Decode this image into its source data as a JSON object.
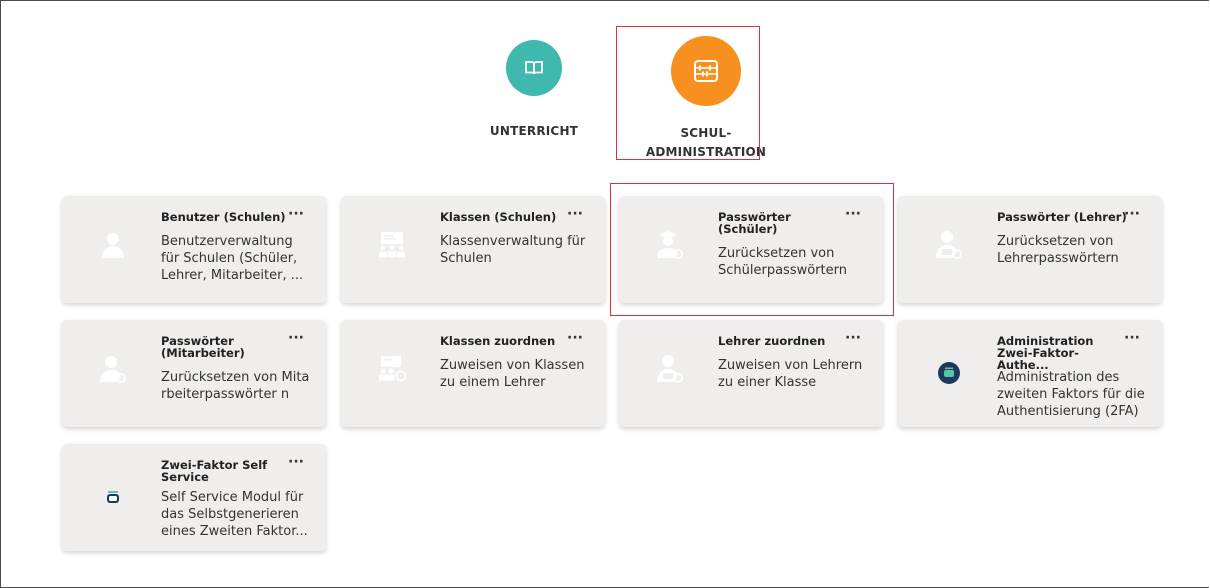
{
  "categories": [
    {
      "label": "UNTERRICHT",
      "icon": "book-icon",
      "color": "#3fb8ae"
    },
    {
      "label_line1": "SCHUL-",
      "label_line2": "ADMINISTRATION",
      "icon": "abacus-icon",
      "color": "#f7901e"
    }
  ],
  "tiles": [
    {
      "title": "Benutzer (Schulen)",
      "desc": "Benutzerverwaltung für Schulen (Schüler, Lehrer, Mitarbeiter, ...",
      "menu": "···",
      "icon": "user-icon"
    },
    {
      "title": "Klassen (Schulen)",
      "desc": "Klassenverwaltung für Schulen",
      "menu": "···",
      "icon": "classroom-icon"
    },
    {
      "title": "Passwörter (Schüler)",
      "desc": "Zurücksetzen von Schülerpasswörtern",
      "menu": "···",
      "icon": "student-key-icon"
    },
    {
      "title": "Passwörter (Lehrer)",
      "desc": "Zurücksetzen von Lehrerpasswörtern",
      "menu": "···",
      "icon": "teacher-key-icon"
    },
    {
      "title": "Passwörter (Mitarbeiter)",
      "desc": "Zurücksetzen von Mitarbeiterpasswörter n",
      "menu": "···",
      "icon": "staff-key-icon"
    },
    {
      "title": "Klassen zuordnen",
      "desc": "Zuweisen von Klassen zu einem Lehrer",
      "menu": "···",
      "icon": "class-assign-icon"
    },
    {
      "title": "Lehrer zuordnen",
      "desc": "Zuweisen von Lehrern zu einer Klasse",
      "menu": "···",
      "icon": "teacher-assign-icon"
    },
    {
      "title": "Administration Zwei-Faktor-Authe...",
      "desc": "Administration des zweiten Faktors für die Authentisierung (2FA)",
      "menu": "···",
      "icon": "2fa-admin-icon"
    },
    {
      "title": "Zwei-Faktor Self Service",
      "desc": "Self Service Modul für das Selbstgenerieren eines Zweiten Faktor...",
      "menu": "···",
      "icon": "2fa-self-service-icon"
    }
  ],
  "colors": {
    "teal": "#3fb8ae",
    "orange": "#f7901e",
    "highlight": "#d9333f",
    "tile_bg": "#efeeed",
    "icon_white": "#ffffff",
    "otp_navy": "#1d3a5c",
    "otp_green": "#5bc4a4"
  }
}
